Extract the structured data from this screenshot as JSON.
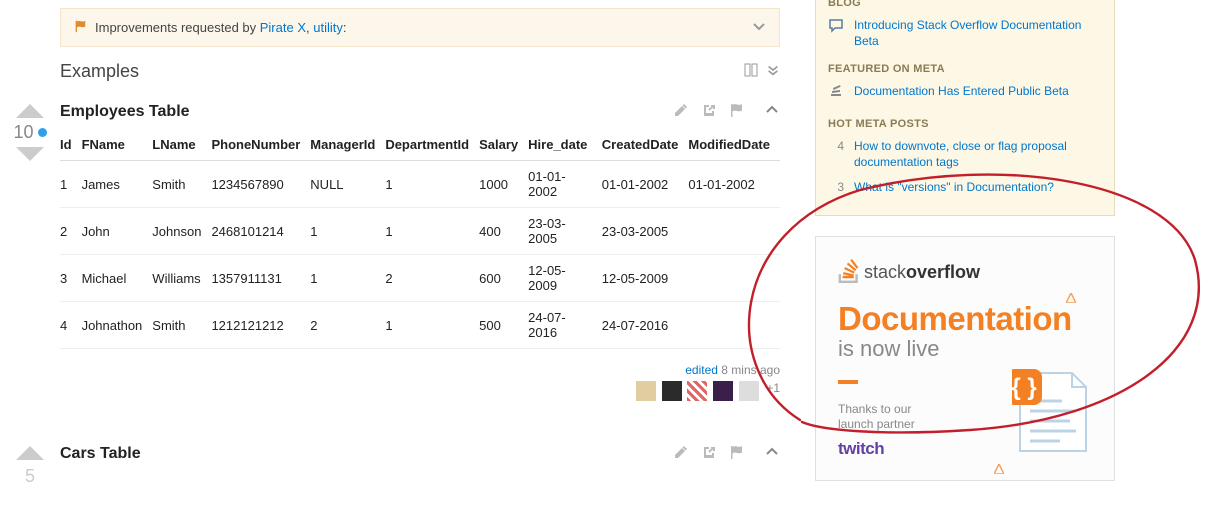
{
  "notice": {
    "prefix": "Improvements requested by ",
    "user1": "Pirate X",
    "sep": ", ",
    "user2": "utility",
    "colon": ":"
  },
  "examples_heading": "Examples",
  "examples": [
    {
      "title": "Employees Table",
      "score": "10",
      "has_dot": true,
      "headers": [
        "Id",
        "FName",
        "LName",
        "PhoneNumber",
        "ManagerId",
        "DepartmentId",
        "Salary",
        "Hire_date",
        "CreatedDate",
        "ModifiedDate"
      ],
      "rows": [
        [
          "1",
          "James",
          "Smith",
          "1234567890",
          "NULL",
          "1",
          "1000",
          "01-01-2002",
          "01-01-2002",
          "01-01-2002"
        ],
        [
          "2",
          "John",
          "Johnson",
          "2468101214",
          "1",
          "1",
          "400",
          "23-03-2005",
          "23-03-2005",
          ""
        ],
        [
          "3",
          "Michael",
          "Williams",
          "1357911131",
          "1",
          "2",
          "600",
          "12-05-2009",
          "12-05-2009",
          ""
        ],
        [
          "4",
          "Johnathon",
          "Smith",
          "1212121212",
          "2",
          "1",
          "500",
          "24-07-2016",
          "24-07-2016",
          ""
        ]
      ],
      "edited_label": "edited",
      "edited_time": "8 mins ago",
      "avatar_overflow": "+1"
    },
    {
      "title": "Cars Table",
      "score": "5",
      "has_dot": false
    }
  ],
  "sidebar": {
    "blog_heading": "BLOG",
    "blog_item": "Introducing Stack Overflow Documentation Beta",
    "featured_heading": "FEATURED ON META",
    "featured_item": "Documentation Has Entered Public Beta",
    "hotmeta_heading": "HOT META POSTS",
    "hot": [
      {
        "num": "4",
        "text": "How to downvote, close or flag proposal documentation tags"
      },
      {
        "num": "3",
        "text": "What is \"versions\" in Documentation?"
      }
    ]
  },
  "ad": {
    "brand_a": "stack",
    "brand_b": "overflow",
    "headline": "Documentation",
    "sub": "is now live",
    "thanks1": "Thanks to our",
    "thanks2": "launch partner",
    "partner": "twitch"
  }
}
